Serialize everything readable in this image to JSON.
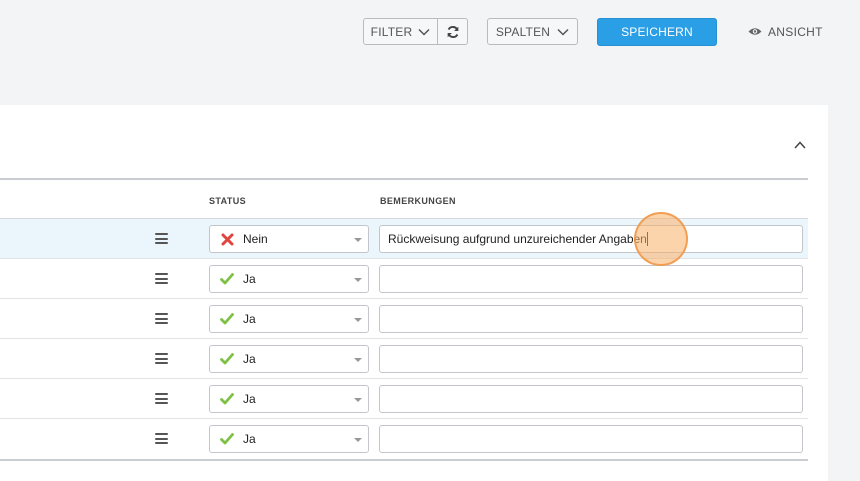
{
  "toolbar": {
    "filter_label": "FILTER",
    "refresh_icon": "refresh-icon",
    "columns_label": "SPALTEN",
    "save_label": "SPEICHERN",
    "view_label": "ANSICHT",
    "view_icon": "eye-icon"
  },
  "table": {
    "columns": [
      "STATUS",
      "BEMERKUNGEN"
    ],
    "rows": [
      {
        "status": "Nein",
        "status_icon": "cross-icon",
        "remark": "Rückweisung aufgrund unzureichender Angaben",
        "selected": true
      },
      {
        "status": "Ja",
        "status_icon": "check-icon",
        "remark": ""
      },
      {
        "status": "Ja",
        "status_icon": "check-icon",
        "remark": ""
      },
      {
        "status": "Ja",
        "status_icon": "check-icon",
        "remark": ""
      },
      {
        "status": "Ja",
        "status_icon": "check-icon",
        "remark": ""
      },
      {
        "status": "Ja",
        "status_icon": "check-icon",
        "remark": ""
      }
    ]
  },
  "colors": {
    "primary": "#2b9fe6",
    "check": "#7cc242",
    "cross": "#e0443e",
    "selected_row": "#eaf5fc"
  }
}
